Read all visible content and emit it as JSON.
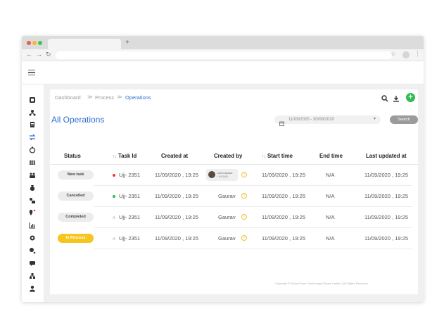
{
  "browser": {
    "new_tab": "+",
    "back": "←",
    "forward": "→",
    "reload": "↻",
    "star": "☆",
    "menu": "⋮"
  },
  "breadcrumb": {
    "items": [
      "Dashboard",
      "Process",
      "Operations"
    ],
    "separator": "≫"
  },
  "page": {
    "title": "All Operations",
    "date_range": "11/09/2020 - 30/09/2020",
    "search_label": "Search",
    "add_label": "+"
  },
  "table": {
    "headers": [
      "Status",
      "Task Id",
      "Created at",
      "Created by",
      "Start time",
      "End time",
      "Last updated at"
    ],
    "sortable_icon": "↑↓",
    "rows": [
      {
        "status": "New task",
        "status_type": "new",
        "dot_color": "#e53935",
        "task_id": "Ujj- 2351",
        "created_at": "11/09/2020 , 19:25",
        "created_by": "",
        "creator_line1": "Lorem ispaura",
        "creator_line2": "+ 9911881",
        "start_time": "11/09/2020 , 19:25",
        "end_time": "N/A",
        "last_updated": "11/09/2020 , 19:25"
      },
      {
        "status": "Cancelled",
        "status_type": "cancelled",
        "dot_color": "#2fbd55",
        "task_id": "Ujj- 2351",
        "created_at": "11/09/2020 , 19:25",
        "created_by": "Gaurav",
        "start_time": "11/09/2020 , 19:25",
        "end_time": "N/A",
        "last_updated": "11/09/2020 , 19:25"
      },
      {
        "status": "Completed",
        "status_type": "completed",
        "dot_color": "#dddddd",
        "task_id": "Ujj- 2351",
        "created_at": "11/09/2020 , 19:25",
        "created_by": "Gaurav",
        "start_time": "11/09/2020 , 19:25",
        "end_time": "N/A",
        "last_updated": "11/09/2020 , 19:25"
      },
      {
        "status": "In Process",
        "status_type": "inprocess",
        "dot_color": "#dddddd",
        "task_id": "Ujj- 2351",
        "created_at": "11/09/2020 , 19:25",
        "created_by": "Gaurav",
        "start_time": "11/09/2020 , 19:25",
        "end_time": "N/A",
        "last_updated": "11/09/2020 , 19:25"
      }
    ]
  },
  "colors": {
    "accent": "#2f6ed0",
    "add_button": "#2fbd55",
    "in_process": "#f7c51f"
  },
  "footer": {
    "text": "Copyright © Rocket Flyer Technology Private Limited  |  All Rights Reserved"
  }
}
